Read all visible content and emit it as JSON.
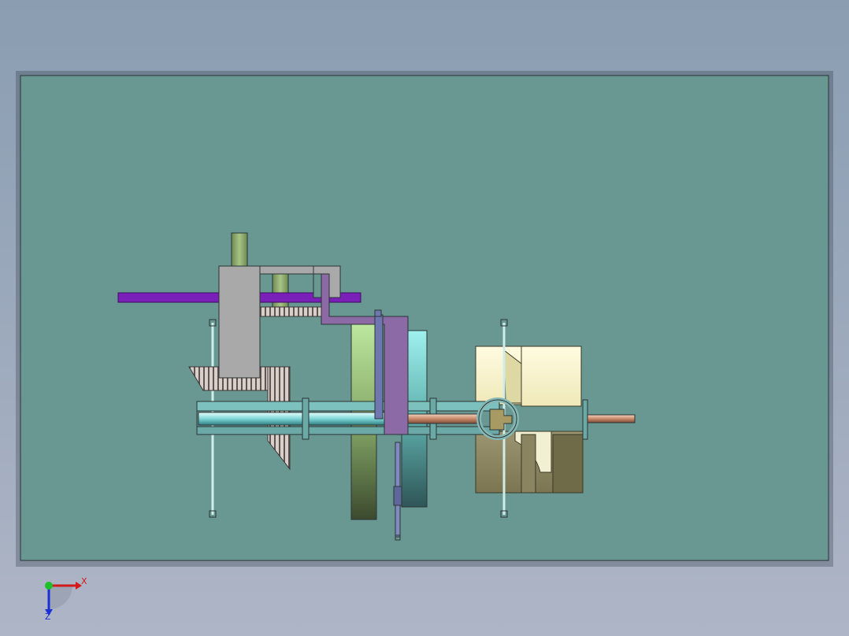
{
  "viewport": {
    "background_top": "#8a9db1",
    "background_bottom": "#aeb5c6",
    "sheet_color": "#699893"
  },
  "triad": {
    "x_label": "X",
    "z_label": "Z",
    "x_color": "#d21a1a",
    "y_color": "#1fbf2a",
    "z_color": "#1a2fd6"
  },
  "model": {
    "parts": [
      "vertical-green-shaft",
      "purple-horizontal-bar",
      "gray-housing",
      "rack-gear",
      "bevel-gear",
      "main-shaft",
      "purple-crank-arm",
      "green-disc",
      "cyan-disc",
      "yellow-motor",
      "tan-base",
      "copper-output-shaft",
      "coupling-ring",
      "tie-rod-left",
      "tie-rod-right",
      "vertical-push-rod"
    ]
  }
}
